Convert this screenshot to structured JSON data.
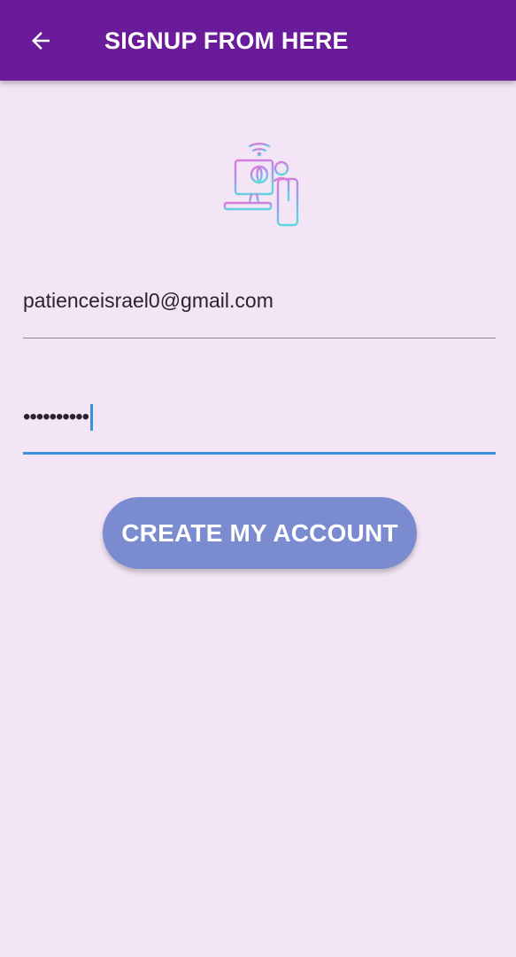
{
  "appbar": {
    "back_icon": "arrow-back-icon",
    "title": "SIGNUP FROM HERE",
    "background_color": "#6a1b9a"
  },
  "logo": {
    "icon": "person-at-computer-network-icon",
    "gradient_colors": [
      "#e27ad8",
      "#a794e6",
      "#62d4e0"
    ]
  },
  "form": {
    "email": {
      "value": "patienceisrael0@gmail.com"
    },
    "password": {
      "masked_value": "••••••••••",
      "focused": true
    },
    "submit_label": "CREATE MY ACCOUNT"
  },
  "colors": {
    "background": "#f3e5f5",
    "button": "#7b8bd0",
    "focus_underline": "#3b8fe0"
  }
}
